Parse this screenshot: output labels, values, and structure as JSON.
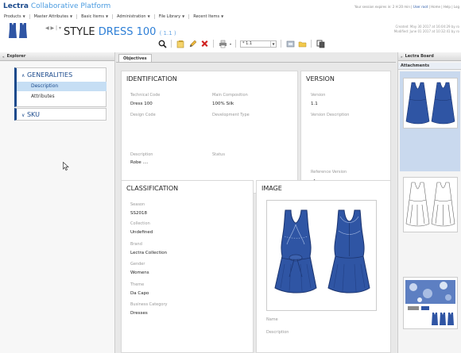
{
  "header": {
    "brand_primary": "Lectra",
    "brand_secondary": "Collaborative Platform",
    "session_text": "Your session expires in: 2 H 20 min |",
    "user_link": "User root",
    "home_link": "Home",
    "help_link": "Help",
    "logout_link": "Log"
  },
  "menu": [
    {
      "label": "Products"
    },
    {
      "label": "Master Attributes"
    },
    {
      "label": "Basic Items"
    },
    {
      "label": "Administration"
    },
    {
      "label": "File Library"
    },
    {
      "label": "Recent Items"
    }
  ],
  "style": {
    "prefix": "STYLE",
    "name": "DRESS 100",
    "version": "( 1.1 )",
    "created": "Created: May 30 2017 at 16:04:29 by ro",
    "modified": "Modified: June 01 2017 at 10:32:41 by ro"
  },
  "toolbar": {
    "version_select": "* 1.1"
  },
  "explorer": {
    "title": "Explorer",
    "generalities": "GENERALITIES",
    "description": "Description",
    "attributes": "Attributes",
    "sku": "SKU"
  },
  "objectives": {
    "tab": "Objectives",
    "identification": {
      "title": "IDENTIFICATION",
      "technical_code_label": "Technical Code",
      "technical_code": "Dress 100",
      "main_composition_label": "Main Composition",
      "main_composition": "100% Silk",
      "design_code_label": "Design Code",
      "development_type_label": "Development Type",
      "description_label": "Description",
      "description": "Robe ....",
      "status_label": "Status"
    },
    "version": {
      "title": "VERSION",
      "version_label": "Version",
      "version": "1.1",
      "version_description_label": "Version Description",
      "reference_version_label": "Reference Version",
      "reference_check": "✔"
    },
    "classification": {
      "title": "CLASSIFICATION",
      "season_label": "Season",
      "season": "SS2018",
      "collection_label": "Collection",
      "collection": "Undefined",
      "brand_label": "Brand",
      "brand": "Lectra Collection",
      "gender_label": "Gender",
      "gender": "Womens",
      "theme_label": "Theme",
      "theme": "Da Capo",
      "business_category_label": "Business Category",
      "business_category": "Dresses"
    },
    "image": {
      "title": "IMAGE",
      "name_label": "Name",
      "description_label": "Description"
    }
  },
  "board": {
    "title": "Lectra Board",
    "attachments": "Attachments"
  },
  "colors": {
    "brand_dark": "#1b4a8c",
    "brand_light": "#4a9be0",
    "dress_blue": "#2f55a4",
    "selection": "#c6def4"
  }
}
